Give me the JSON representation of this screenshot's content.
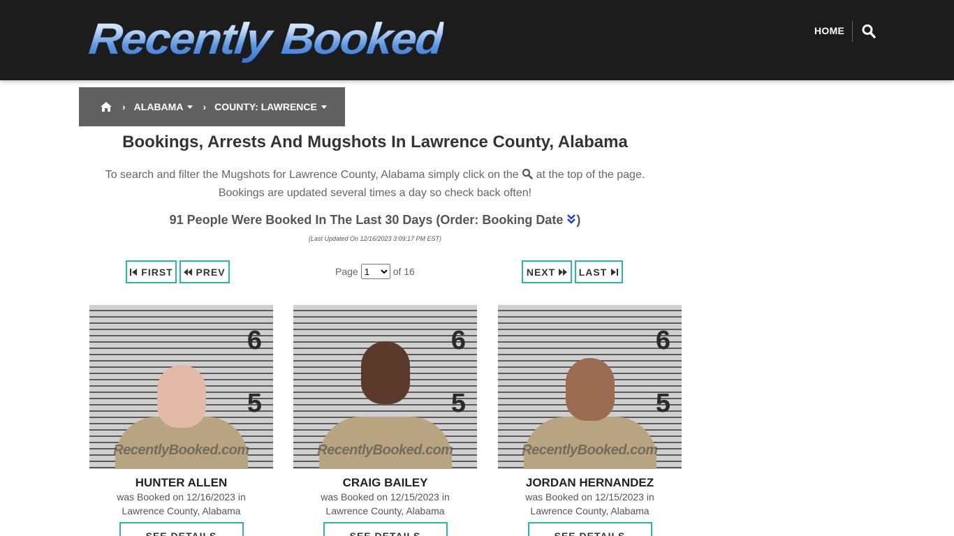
{
  "header": {
    "logo_text": "Recently Booked",
    "nav_home": "HOME",
    "search_icon": "search-icon"
  },
  "breadcrumb": {
    "home_icon": "home-icon",
    "items": [
      {
        "label": "ALABAMA"
      },
      {
        "label": "COUNTY: LAWRENCE"
      }
    ]
  },
  "main": {
    "title": "Bookings, Arrests And Mugshots In Lawrence County, Alabama",
    "desc_part1": "To search and filter the Mugshots for Lawrence County, Alabama simply click on the",
    "desc_part2": "at the top of the page.",
    "desc_line2": "Bookings are updated several times a day so check back often!",
    "count_text": "91 People Were Booked In The Last 30 Days (Order: Booking Date",
    "count_close": ")",
    "last_updated": "(Last Updated On 12/16/2023 3:09:17 PM EST)"
  },
  "pagination": {
    "first": "FIRST",
    "prev": "PREV",
    "next": "NEXT",
    "last": "LAST",
    "page_label": "Page",
    "current_page": "1",
    "of_label": "of 16"
  },
  "bookings": [
    {
      "name": "HUNTER ALLEN",
      "line1": "was Booked on 12/16/2023 in",
      "line2": "Lawrence County, Alabama",
      "details": "SEE DETAILS",
      "watermark": "RecentlyBooked.com"
    },
    {
      "name": "CRAIG BAILEY",
      "line1": "was Booked on 12/15/2023 in",
      "line2": "Lawrence County, Alabama",
      "details": "SEE DETAILS",
      "watermark": "RecentlyBooked.com"
    },
    {
      "name": "JORDAN HERNANDEZ",
      "line1": "was Booked on 12/15/2023 in",
      "line2": "Lawrence County, Alabama",
      "details": "SEE DETAILS",
      "watermark": "RecentlyBooked.com"
    }
  ],
  "colors": {
    "header_bg": "#1c1c1c",
    "breadcrumb_bg": "#616161",
    "button_border": "#2bb5a8",
    "sort_icon": "#1a3fc4"
  }
}
